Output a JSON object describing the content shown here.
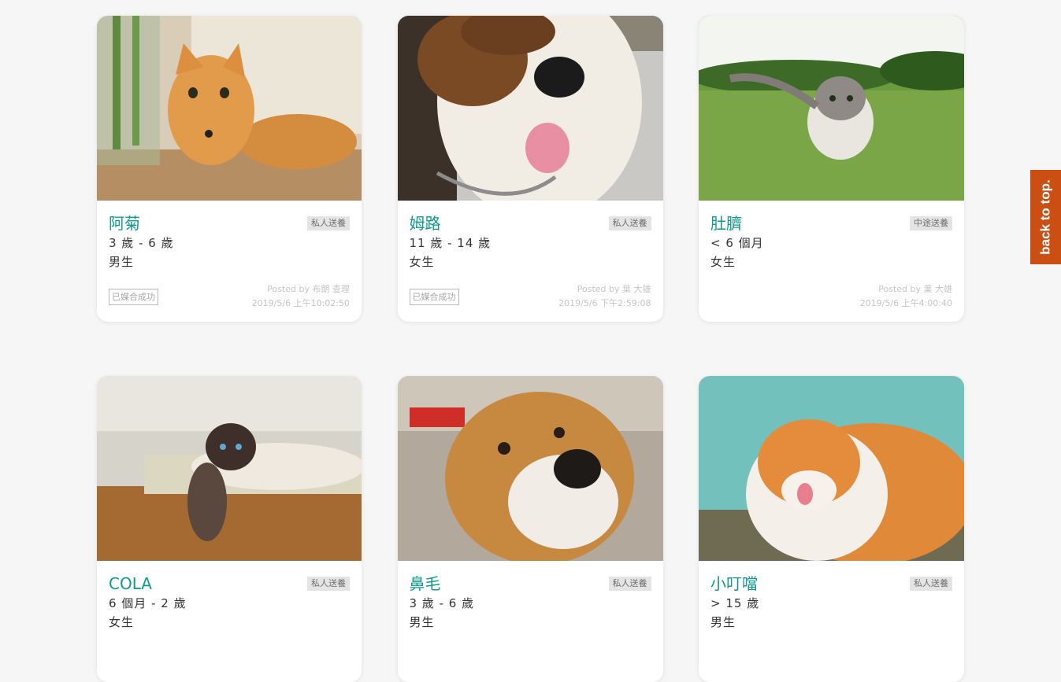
{
  "back_to_top": "back to top.",
  "posted_by_prefix": "Posted by",
  "pets": [
    {
      "name": "阿菊",
      "type": "私人送養",
      "age": "3 歲 - 6 歲",
      "gender": "男生",
      "status": "已媒合成功",
      "poster": "Posted by 布朗 查理",
      "date": "2019/5/6 上午10:02:50",
      "photo": "orange-cat-photo"
    },
    {
      "name": "姆路",
      "type": "私人送養",
      "age": "11 歲 - 14 歲",
      "gender": "女生",
      "status": "已媒合成功",
      "poster": "Posted by 葉 大雄",
      "date": "2019/5/6 下午2:59:08",
      "photo": "beagle-dog-photo"
    },
    {
      "name": "肚臍",
      "type": "中途送養",
      "age": "< 6 個月",
      "gender": "女生",
      "status": "",
      "poster": "Posted by 葉 大雄",
      "date": "2019/5/6 上午4:00:40",
      "photo": "kitten-on-grass-photo"
    },
    {
      "name": "COLA",
      "type": "私人送養",
      "age": "6 個月 - 2 歲",
      "gender": "女生",
      "status": "",
      "poster": "",
      "date": "",
      "photo": "siamese-cat-photo"
    },
    {
      "name": "鼻毛",
      "type": "私人送養",
      "age": "3 歲 - 6 歲",
      "gender": "男生",
      "status": "",
      "poster": "",
      "date": "",
      "photo": "tan-dog-photo"
    },
    {
      "name": "小叮噹",
      "type": "私人送養",
      "age": "> 15 歲",
      "gender": "男生",
      "status": "",
      "poster": "",
      "date": "",
      "photo": "ginger-white-cat-photo"
    }
  ]
}
